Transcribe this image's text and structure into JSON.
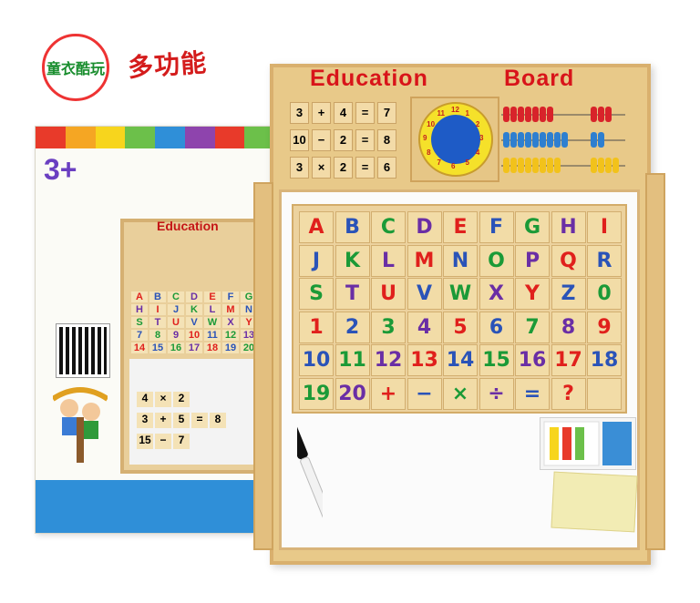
{
  "box": {
    "brand_text": "童衣酷玩",
    "title_text": "多功能",
    "age_badge": "3+",
    "mini_board_title": "Education",
    "mini_letters": [
      "A",
      "B",
      "C",
      "D",
      "E",
      "F",
      "G",
      "H",
      "I",
      "J",
      "K",
      "L",
      "M",
      "N",
      "S",
      "T",
      "U",
      "V",
      "W",
      "X",
      "Y",
      "7",
      "8",
      "9",
      "10",
      "11",
      "12",
      "13",
      "14",
      "15",
      "16",
      "17",
      "18",
      "19",
      "20"
    ],
    "mini_math": [
      [
        "4",
        "×",
        "2"
      ],
      [
        "3",
        "+",
        "5",
        "=",
        "8"
      ],
      [
        "15",
        "−",
        "7"
      ]
    ]
  },
  "board": {
    "title_left": "Education",
    "title_right": "Board",
    "math_rows": [
      [
        "3",
        "+",
        "4",
        "=",
        "7"
      ],
      [
        "10",
        "−",
        "2",
        "=",
        "8"
      ],
      [
        "3",
        "×",
        "2",
        "=",
        "6"
      ]
    ],
    "clock_numbers": [
      "12",
      "1",
      "2",
      "3",
      "4",
      "5",
      "6",
      "7",
      "8",
      "9",
      "10",
      "11"
    ],
    "tiles": [
      {
        "t": "A",
        "c": "#e0201c"
      },
      {
        "t": "B",
        "c": "#2a53b8"
      },
      {
        "t": "C",
        "c": "#1b9a37"
      },
      {
        "t": "D",
        "c": "#6a2ea5"
      },
      {
        "t": "E",
        "c": "#e0201c"
      },
      {
        "t": "F",
        "c": "#2a53b8"
      },
      {
        "t": "G",
        "c": "#1b9a37"
      },
      {
        "t": "H",
        "c": "#6a2ea5"
      },
      {
        "t": "I",
        "c": "#e0201c"
      },
      {
        "t": "J",
        "c": "#2a53b8"
      },
      {
        "t": "K",
        "c": "#1b9a37"
      },
      {
        "t": "L",
        "c": "#6a2ea5"
      },
      {
        "t": "M",
        "c": "#e0201c"
      },
      {
        "t": "N",
        "c": "#2a53b8"
      },
      {
        "t": "O",
        "c": "#1b9a37"
      },
      {
        "t": "P",
        "c": "#6a2ea5"
      },
      {
        "t": "Q",
        "c": "#e0201c"
      },
      {
        "t": "R",
        "c": "#2a53b8"
      },
      {
        "t": "S",
        "c": "#1b9a37"
      },
      {
        "t": "T",
        "c": "#6a2ea5"
      },
      {
        "t": "U",
        "c": "#e0201c"
      },
      {
        "t": "V",
        "c": "#2a53b8"
      },
      {
        "t": "W",
        "c": "#1b9a37"
      },
      {
        "t": "X",
        "c": "#6a2ea5"
      },
      {
        "t": "Y",
        "c": "#e0201c"
      },
      {
        "t": "Z",
        "c": "#2a53b8"
      },
      {
        "t": "0",
        "c": "#1b9a37"
      },
      {
        "t": "1",
        "c": "#e0201c"
      },
      {
        "t": "2",
        "c": "#2a53b8"
      },
      {
        "t": "3",
        "c": "#1b9a37"
      },
      {
        "t": "4",
        "c": "#6a2ea5"
      },
      {
        "t": "5",
        "c": "#e0201c"
      },
      {
        "t": "6",
        "c": "#2a53b8"
      },
      {
        "t": "7",
        "c": "#1b9a37"
      },
      {
        "t": "8",
        "c": "#6a2ea5"
      },
      {
        "t": "9",
        "c": "#e0201c"
      },
      {
        "t": "10",
        "c": "#2a53b8"
      },
      {
        "t": "11",
        "c": "#1b9a37"
      },
      {
        "t": "12",
        "c": "#6a2ea5"
      },
      {
        "t": "13",
        "c": "#e0201c"
      },
      {
        "t": "14",
        "c": "#2a53b8"
      },
      {
        "t": "15",
        "c": "#1b9a37"
      },
      {
        "t": "16",
        "c": "#6a2ea5"
      },
      {
        "t": "17",
        "c": "#e0201c"
      },
      {
        "t": "18",
        "c": "#2a53b8"
      },
      {
        "t": "19",
        "c": "#1b9a37"
      },
      {
        "t": "20",
        "c": "#6a2ea5"
      },
      {
        "t": "+",
        "c": "#e0201c"
      },
      {
        "t": "−",
        "c": "#2a53b8"
      },
      {
        "t": "×",
        "c": "#1b9a37"
      },
      {
        "t": "÷",
        "c": "#6a2ea5"
      },
      {
        "t": "=",
        "c": "#2a53b8"
      },
      {
        "t": "?",
        "c": "#e0201c"
      },
      {
        "t": "",
        "c": "#000000"
      }
    ]
  },
  "colors": {
    "wood": "#e8c989",
    "title_red": "#d8141a",
    "bead_red": "#d8232a",
    "bead_blue": "#2e7fd0",
    "bead_yellow": "#f2c21b"
  }
}
